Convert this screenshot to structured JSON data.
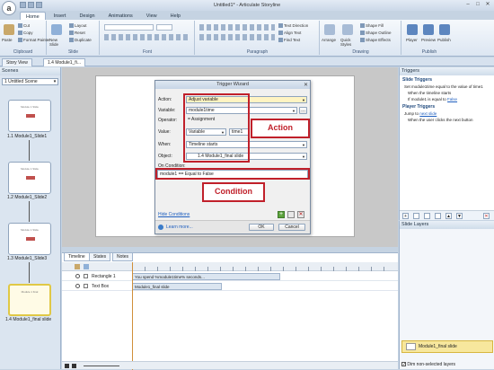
{
  "app": {
    "title": "Untitled1* - Articulate Storyline",
    "logo": "a"
  },
  "ribbon": {
    "tabs": [
      "Home",
      "Insert",
      "Design",
      "Animations",
      "View",
      "Help"
    ],
    "active_tab": "Home",
    "groups": {
      "clipboard": {
        "label": "Clipboard",
        "paste": "Paste",
        "cut": "Cut",
        "copy": "Copy",
        "format_painter": "Format Painter"
      },
      "slide": {
        "label": "Slide",
        "new_slide": "New Slide",
        "layout": "Layout",
        "reset": "Reset",
        "duplicate": "Duplicate"
      },
      "font": {
        "label": "Font"
      },
      "paragraph": {
        "label": "Paragraph",
        "text_direction": "Text Direction",
        "align_text": "Align Text",
        "find_text": "Find Text"
      },
      "drawing": {
        "label": "Drawing",
        "arrange": "Arrange",
        "quick_styles": "Quick Styles",
        "shape_fill": "Shape Fill",
        "shape_outline": "Shape Outline",
        "shape_effects": "Shape Effects"
      },
      "publish": {
        "label": "Publish",
        "player": "Player",
        "preview": "Preview",
        "publish": "Publish"
      }
    }
  },
  "doc_tabs": [
    "Story View",
    "1.4 Module1_fi..."
  ],
  "scenes": {
    "header": "Scenes",
    "selected_scene": "1 Untitled Scene",
    "slides": [
      {
        "label": "1.1 Module1_Slide1",
        "thumb_text": "Module 1 Slide"
      },
      {
        "label": "1.2 Module1_Slide2",
        "thumb_text": "Module 1 Slide"
      },
      {
        "label": "1.3 Module1_Slide3",
        "thumb_text": "Module 1 Slide"
      },
      {
        "label": "1.4 Module1_final slide",
        "thumb_text": "Module 1 final"
      }
    ]
  },
  "dialog": {
    "title": "Trigger Wizard",
    "action_label": "Action:",
    "action_value": "Adjust variable",
    "variable_label": "Variable:",
    "variable_value": "module1time",
    "operator_label": "Operator:",
    "operator_value": "= Assignment",
    "value_label": "Value:",
    "value_type": "Variable",
    "value_value": "time1",
    "when_label": "When:",
    "when_value": "Timeline starts",
    "object_label": "Object:",
    "object_value": "1.4 Module1_final slide",
    "on_condition_label": "On Condition:",
    "condition_value": "module1 == Equal to False",
    "hide_conditions": "Hide Conditions",
    "learn_more": "Learn more...",
    "ok": "OK",
    "cancel": "Cancel",
    "annot_action": "Action",
    "annot_condition": "Condition"
  },
  "timeline": {
    "tabs": [
      "Timeline",
      "States",
      "Notes"
    ],
    "rows": [
      {
        "name": "Rectangle 1",
        "bar_text": "You spend %module1time% seconds..."
      },
      {
        "name": "Text Box",
        "bar_text": "Module1_final slide"
      }
    ]
  },
  "triggers": {
    "header": "Triggers",
    "slide_triggers_title": "Slide Triggers",
    "slide_line1": "Set module1time equal to the value of time1",
    "slide_line2": "When the timeline starts",
    "slide_line3_prefix": "If module1 is equal to",
    "slide_line3_link": "False",
    "player_triggers_title": "Player Triggers",
    "player_line1_prefix": "Jump to",
    "player_line1_link": "next slide",
    "player_line2": "When the user clicks the next button"
  },
  "layers": {
    "header": "Slide Layers",
    "base_layer": "Module1_final slide",
    "dim_label": "Dim non-selected layers"
  },
  "colors": {
    "annotation_red": "#c0202a",
    "selected_yellow": "#f7e79d",
    "ribbon_blue": "#dce6f2"
  }
}
